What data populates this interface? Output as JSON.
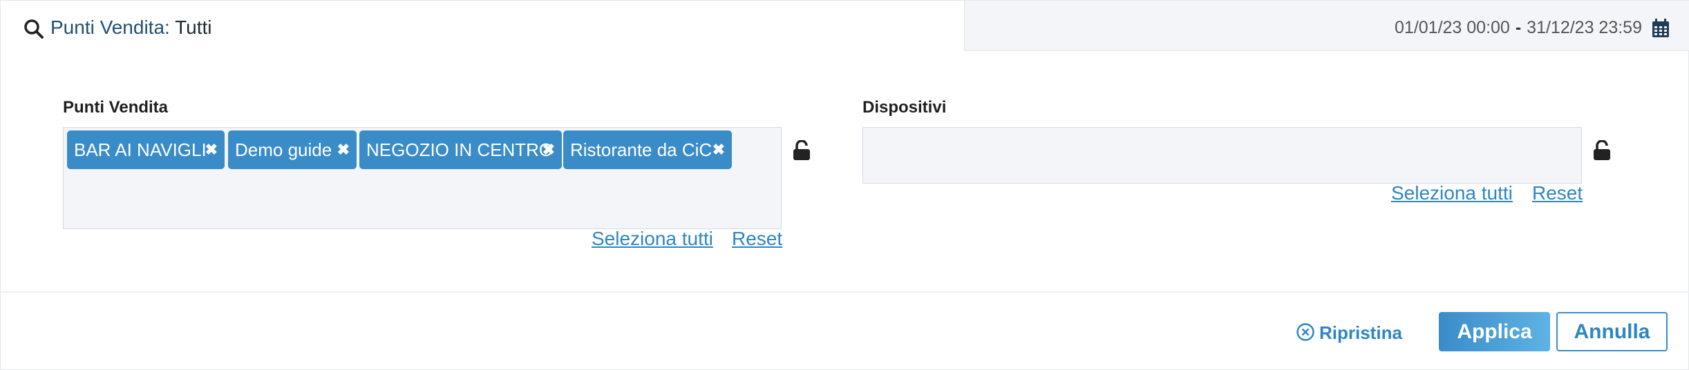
{
  "header": {
    "filter_label": "Punti Vendita:",
    "filter_value": "Tutti",
    "date_start": "01/01/23 00:00",
    "date_separator": "-",
    "date_end": "31/12/23 23:59"
  },
  "punti_vendita": {
    "label": "Punti Vendita",
    "chips": [
      {
        "label": "BAR AI NAVIGLI"
      },
      {
        "label": "Demo guide"
      },
      {
        "label": "NEGOZIO IN CENTRO"
      },
      {
        "label": "Ristorante da CiC"
      }
    ],
    "remove_glyph": "✖",
    "select_all": "Seleziona tutti",
    "reset": "Reset"
  },
  "dispositivi": {
    "label": "Dispositivi",
    "select_all": "Seleziona tutti",
    "reset": "Reset"
  },
  "footer": {
    "ripristina": "Ripristina",
    "applica": "Applica",
    "annulla": "Annulla"
  },
  "colors": {
    "accent": "#2e86c1",
    "chip": "#3a8cc8",
    "field_bg": "#f3f5f8"
  },
  "icons": [
    "search-icon",
    "calendar-icon",
    "lock-open-icon",
    "close-circle-icon",
    "remove-icon"
  ]
}
